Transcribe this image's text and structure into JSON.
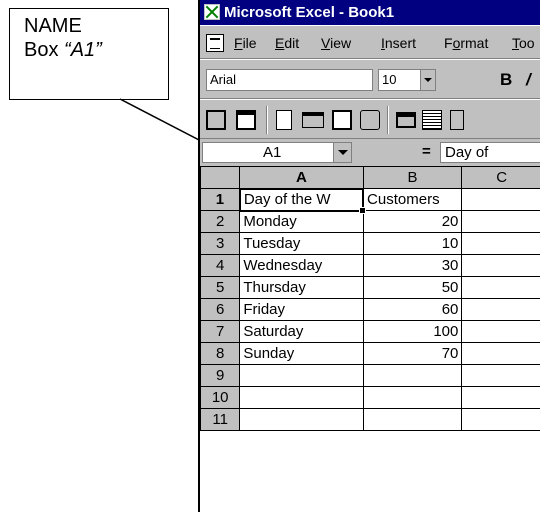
{
  "callout": {
    "line1": "NAME",
    "line2_prefix": "Box ",
    "line2_emph": "“A1”"
  },
  "window": {
    "title": "Microsoft Excel - Book1"
  },
  "menu": {
    "items": [
      {
        "u": "F",
        "rest": "ile"
      },
      {
        "u": "E",
        "rest": "dit"
      },
      {
        "u": "V",
        "rest": "iew"
      },
      {
        "u": "I",
        "rest": "nsert"
      },
      {
        "pre": "F",
        "u": "o",
        "rest": "rmat"
      },
      {
        "u": "T",
        "rest": "oo"
      }
    ]
  },
  "formatting": {
    "font": "Arial",
    "size": "10",
    "bold": "B"
  },
  "formula_bar": {
    "name_box": "A1",
    "equals": "=",
    "value": "Day of"
  },
  "sheet": {
    "columns": [
      "A",
      "B",
      "C"
    ],
    "rows": [
      {
        "n": "1",
        "a": "Day of the W",
        "b": "Customers"
      },
      {
        "n": "2",
        "a": "Monday",
        "b": "20"
      },
      {
        "n": "3",
        "a": "Tuesday",
        "b": "10"
      },
      {
        "n": "4",
        "a": "Wednesday",
        "b": "30"
      },
      {
        "n": "5",
        "a": "Thursday",
        "b": "50"
      },
      {
        "n": "6",
        "a": "Friday",
        "b": "60"
      },
      {
        "n": "7",
        "a": "Saturday",
        "b": "100"
      },
      {
        "n": "8",
        "a": "Sunday",
        "b": "70"
      },
      {
        "n": "9",
        "a": "",
        "b": ""
      },
      {
        "n": "10",
        "a": "",
        "b": ""
      },
      {
        "n": "11",
        "a": "",
        "b": ""
      }
    ]
  }
}
